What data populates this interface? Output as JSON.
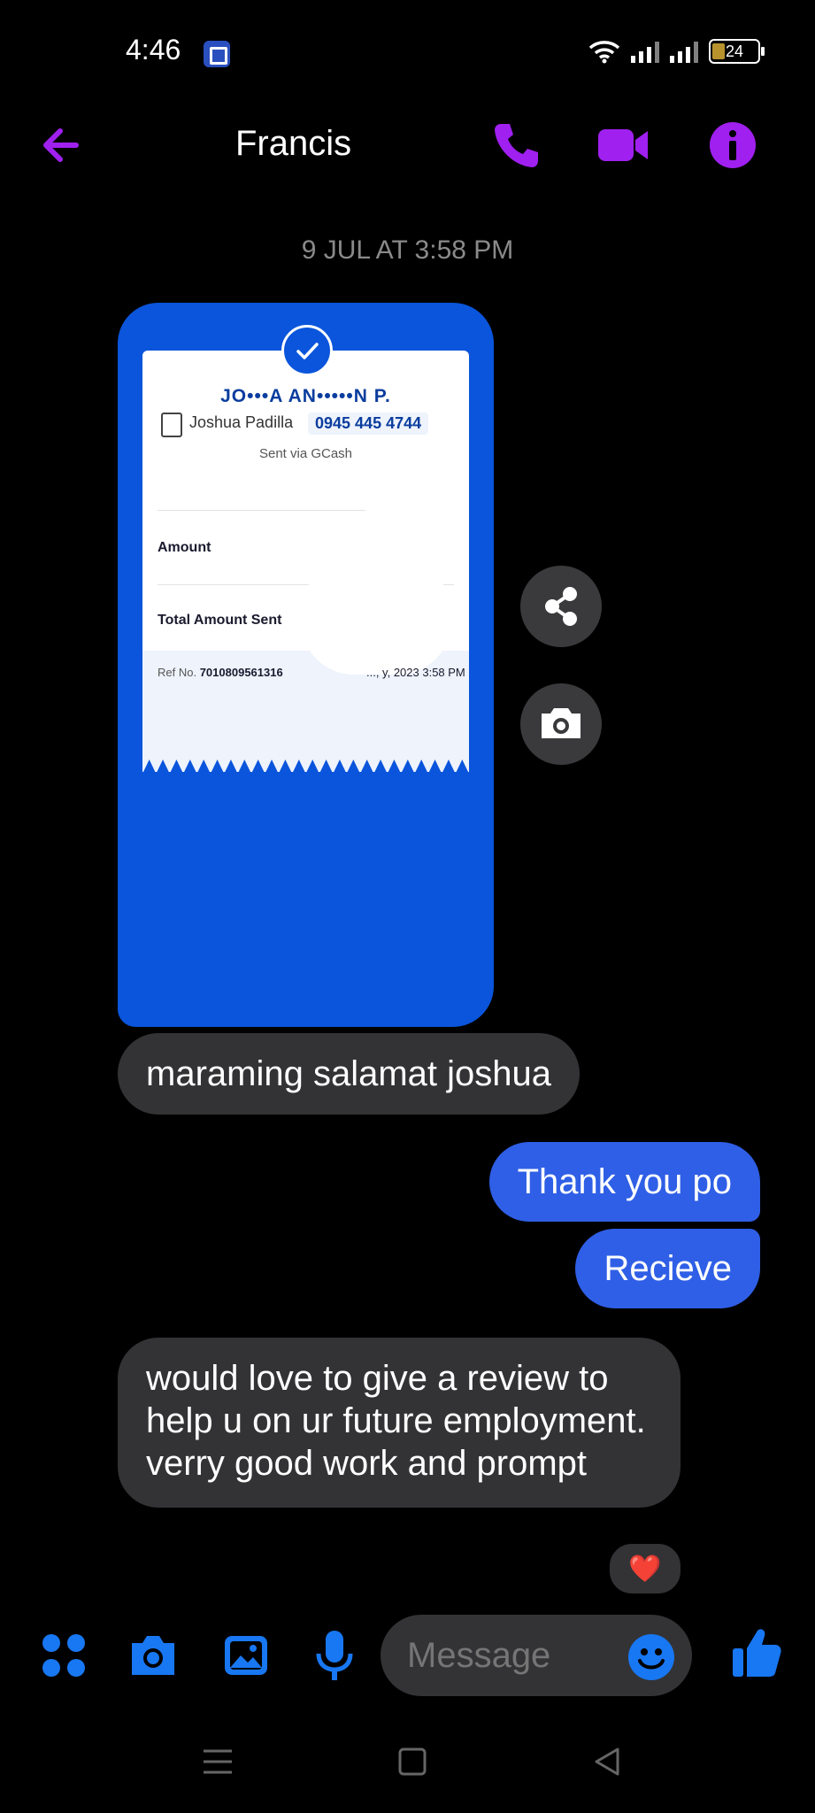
{
  "status_bar": {
    "time": "4:46",
    "battery": "24"
  },
  "header": {
    "contact_name": "Francis"
  },
  "conversation": {
    "timestamp": "9 JUL AT 3:58 PM",
    "receipt": {
      "recipient_name": "JO•••A AN•••••N P.",
      "contact_name": "Joshua Padilla",
      "phone": "0945 445 4744",
      "sent_via": "Sent via GCash",
      "amount_label": "Amount",
      "total_label": "Total Amount Sent",
      "ref_label": "Ref No.",
      "ref_number": "7010809561316",
      "datetime": "..., y, 2023 3:58 PM"
    },
    "messages": [
      {
        "sender": "them",
        "text": "maraming salamat joshua"
      },
      {
        "sender": "me",
        "text": "Thank you po"
      },
      {
        "sender": "me",
        "text": "Recieve"
      },
      {
        "sender": "them",
        "text": "would love to give a review to help u on ur future employment. verry good work and prompt",
        "reaction": "❤️"
      }
    ]
  },
  "composer": {
    "placeholder": "Message"
  },
  "colors": {
    "accent": "#a020f0",
    "messenger_blue": "#2f5fe6",
    "gcash_blue": "#0a55db",
    "bubble_gray": "#333335"
  },
  "icons": [
    "back-arrow-icon",
    "phone-icon",
    "video-icon",
    "info-icon",
    "share-icon",
    "camera-icon",
    "apps-icon",
    "gallery-icon",
    "microphone-icon",
    "emoji-icon",
    "thumbs-up-icon",
    "menu-icon",
    "home-icon",
    "back-icon"
  ]
}
